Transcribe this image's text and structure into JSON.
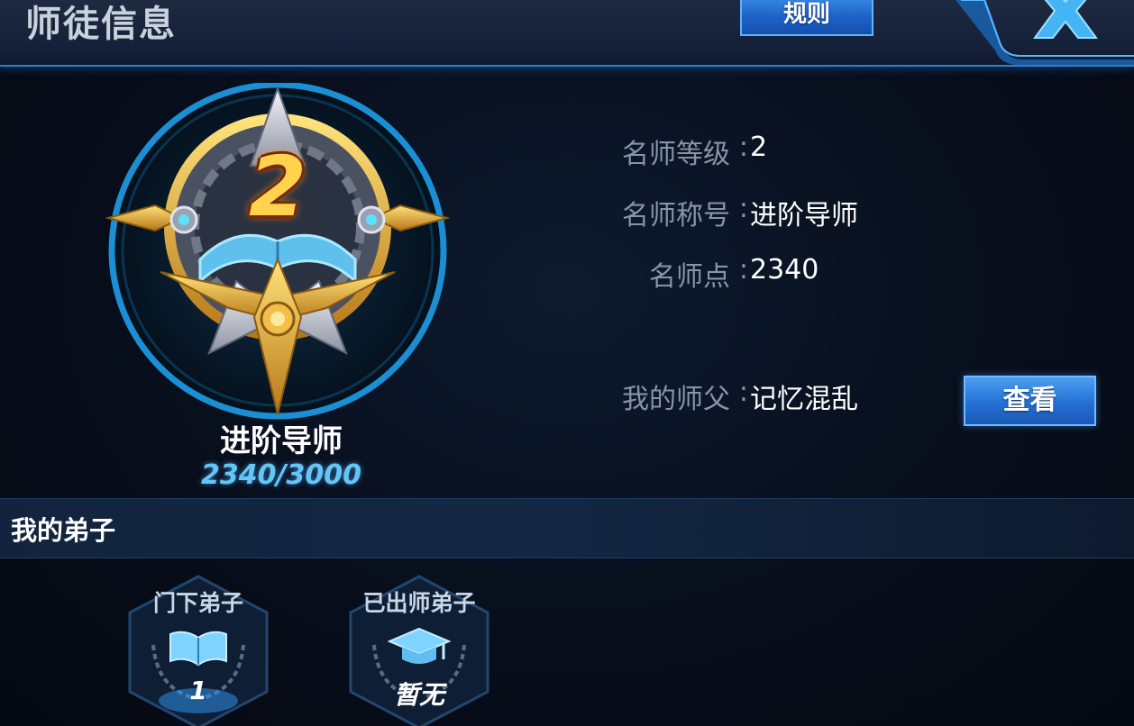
{
  "header": {
    "title": "师徒信息",
    "rules_label": "规则"
  },
  "rank": {
    "level_badge": "2",
    "name": "进阶导师",
    "progress": "2340/3000",
    "progress_fraction": 0.78
  },
  "info": {
    "level_label": "名师等级",
    "level_value": "2",
    "title_label": "名师称号",
    "title_value": "进阶导师",
    "points_label": "名师点",
    "points_value": "2340",
    "master_label": "我的师父",
    "master_value": "记忆混乱",
    "separator": ":"
  },
  "view_button": "查看",
  "disciples": {
    "section_title": "我的弟子",
    "cards": [
      {
        "label": "门下弟子",
        "value": "1",
        "icon": "book-icon"
      },
      {
        "label": "已出师弟子",
        "value": "暂无",
        "icon": "graduation-cap-icon"
      }
    ]
  },
  "colors": {
    "accent": "#2a7fd0",
    "button": "#2470d4",
    "gold": "#e7b53e",
    "progress_text": "#63c6f5"
  }
}
